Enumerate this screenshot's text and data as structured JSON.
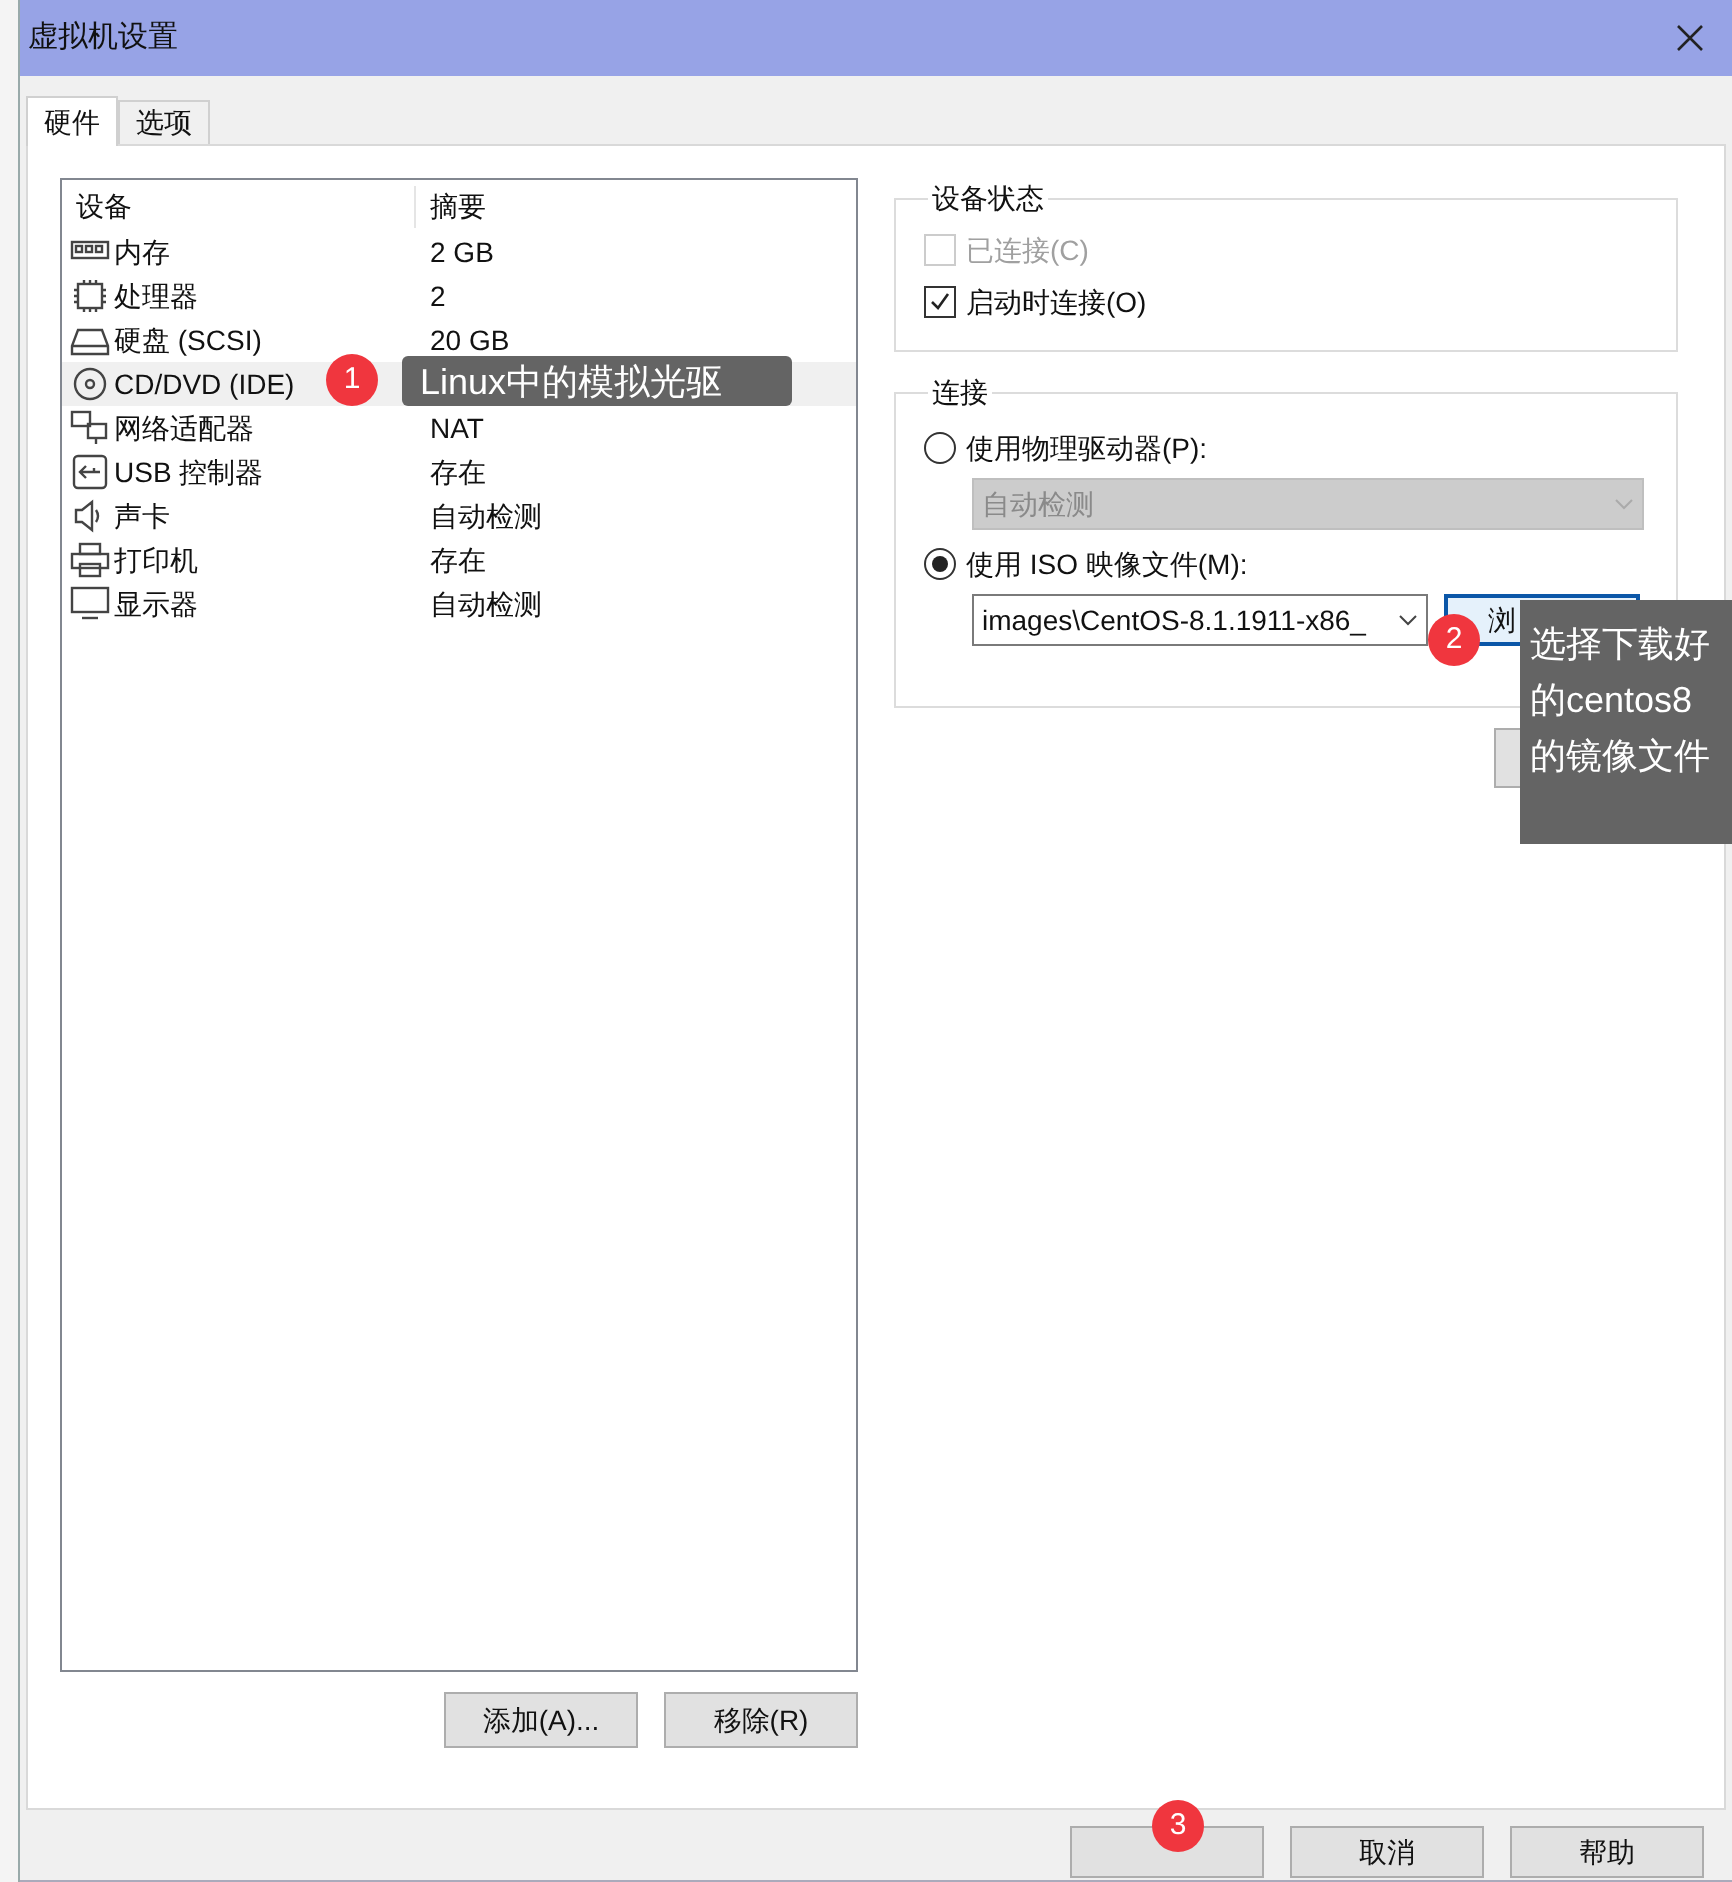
{
  "window": {
    "title": "虚拟机设置"
  },
  "tabs": [
    {
      "label": "硬件",
      "selected": true
    },
    {
      "label": "选项",
      "selected": false
    }
  ],
  "devices": {
    "columns": [
      "设备",
      "摘要"
    ],
    "rows": [
      {
        "name": "内存",
        "summary": "2 GB",
        "selected": false
      },
      {
        "name": "处理器",
        "summary": "2",
        "selected": false
      },
      {
        "name": "硬盘 (SCSI)",
        "summary": "20 GB",
        "selected": false
      },
      {
        "name": "CD/DVD (IDE)",
        "selected": true
      },
      {
        "name": "网络适配器",
        "summary": "NAT",
        "selected": false
      },
      {
        "name": "USB 控制器",
        "summary": "存在",
        "selected": false
      },
      {
        "name": "声卡",
        "summary": "自动检测",
        "selected": false
      },
      {
        "name": "打印机",
        "summary": "存在",
        "selected": false
      },
      {
        "name": "显示器",
        "summary": "自动检测",
        "selected": false
      }
    ]
  },
  "list_buttons": [
    "添加(A)...",
    "移除(R)"
  ],
  "device_status": {
    "title": "设备状态",
    "checkboxes": [
      {
        "label": "已连接(C)",
        "checked": false,
        "disabled": true
      },
      {
        "label": "启动时连接(O)",
        "checked": true,
        "disabled": false
      }
    ]
  },
  "connection": {
    "title": "连接",
    "options": [
      {
        "label": "使用物理驱动器(P):",
        "selected": false,
        "select_value": "自动检测",
        "disabled": true
      },
      {
        "label": "使用 ISO 映像文件(M):",
        "selected": true,
        "select_value": "images\\CentOS-8.1.1911-x86_",
        "disabled": false
      }
    ],
    "browse_button": "浏"
  },
  "dialog_buttons": [
    "取消",
    "帮助"
  ],
  "callouts": [
    {
      "number": "1",
      "text": "Linux中的模拟光驱"
    },
    {
      "number": "2",
      "text": "选择下载好的centos8的镜像文件"
    },
    {
      "number": "3"
    }
  ]
}
